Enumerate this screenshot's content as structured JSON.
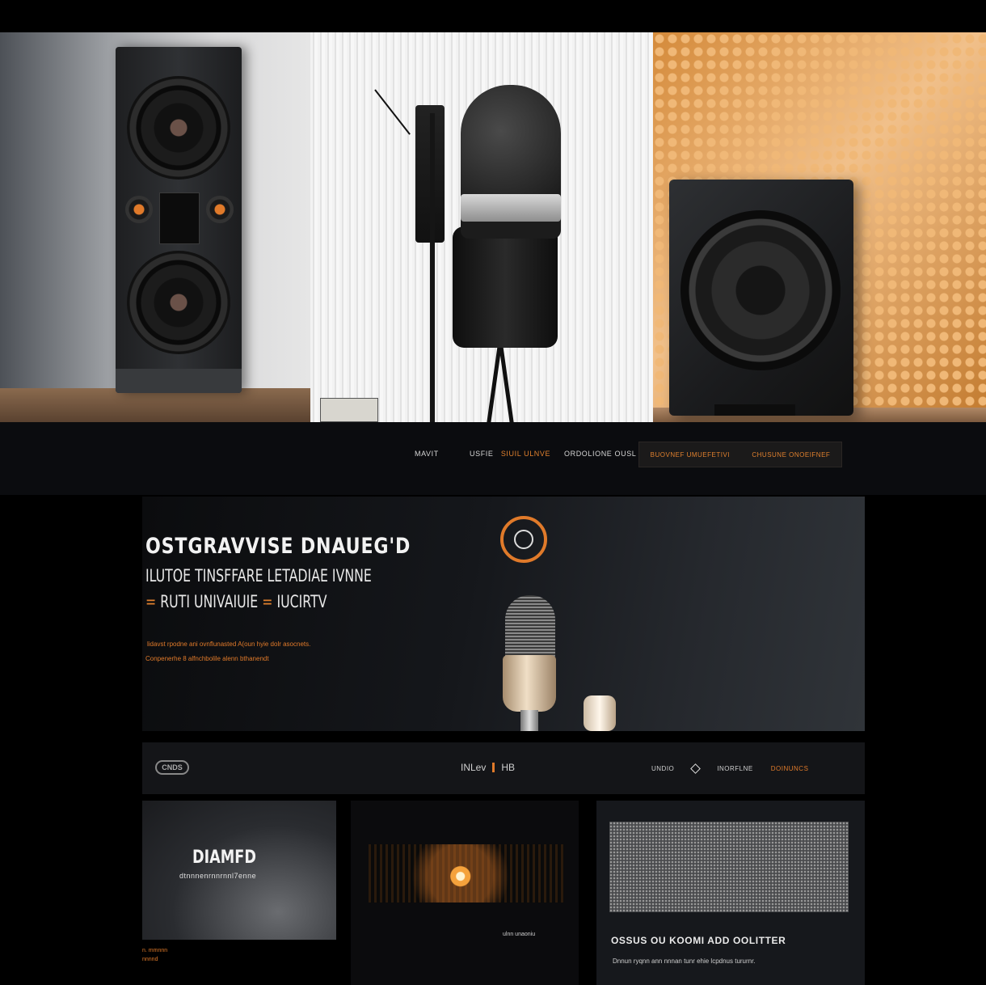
{
  "nav": {
    "item_1": "MAVIT",
    "item_2a": "USFIE",
    "item_2b": "SIUIL ULNVE",
    "item_3": "ORDOLIONE OUSL",
    "cta_left": "BUOVNEF UMUEFETIVI",
    "cta_right": "CHUSUNE ONOEIFNEF"
  },
  "hero": {
    "title": "OSTGRAVVISE DNAUEG'D",
    "subtitle_1": "ILUTOE TINSFFARE LETADIAE IVNNE",
    "subtitle_2_prefix": "=",
    "subtitle_2a": "RUTI UNIVAIUIE",
    "subtitle_2_sep": "=",
    "subtitle_2b": "IUCIRTV",
    "paragraph_1": "lidavst rpodne ani ovnflunasted A(oun hyie dolr asocnets.",
    "paragraph_2": "Conpenerhe 8 alfnchbolile alenn bthanendt"
  },
  "toolbar": {
    "logo_text": "CNDS",
    "mid_label_a": "INLev",
    "mid_label_b": "HB",
    "right_item_1": "UNDIO",
    "right_item_2": "INORFLNE",
    "right_item_3": "DOINUNCS"
  },
  "cards": {
    "card1_title": "DIAMFD",
    "card1_sub": "dtnnnenrnnrnnl7enne",
    "card1_caption_1": "n. mmnnn",
    "card1_caption_2": "nnnnd",
    "card2_caption": "ulnn unaoniu",
    "card3_title": "OSSUS OU KOOMI ADD OOLITTER",
    "card3_desc": "Dnnun ryqnn ann nnnan tunr ehie lcpdnus tururnr."
  },
  "colors": {
    "accent": "#e07a2a",
    "background": "#000000",
    "surface": "#141518"
  }
}
